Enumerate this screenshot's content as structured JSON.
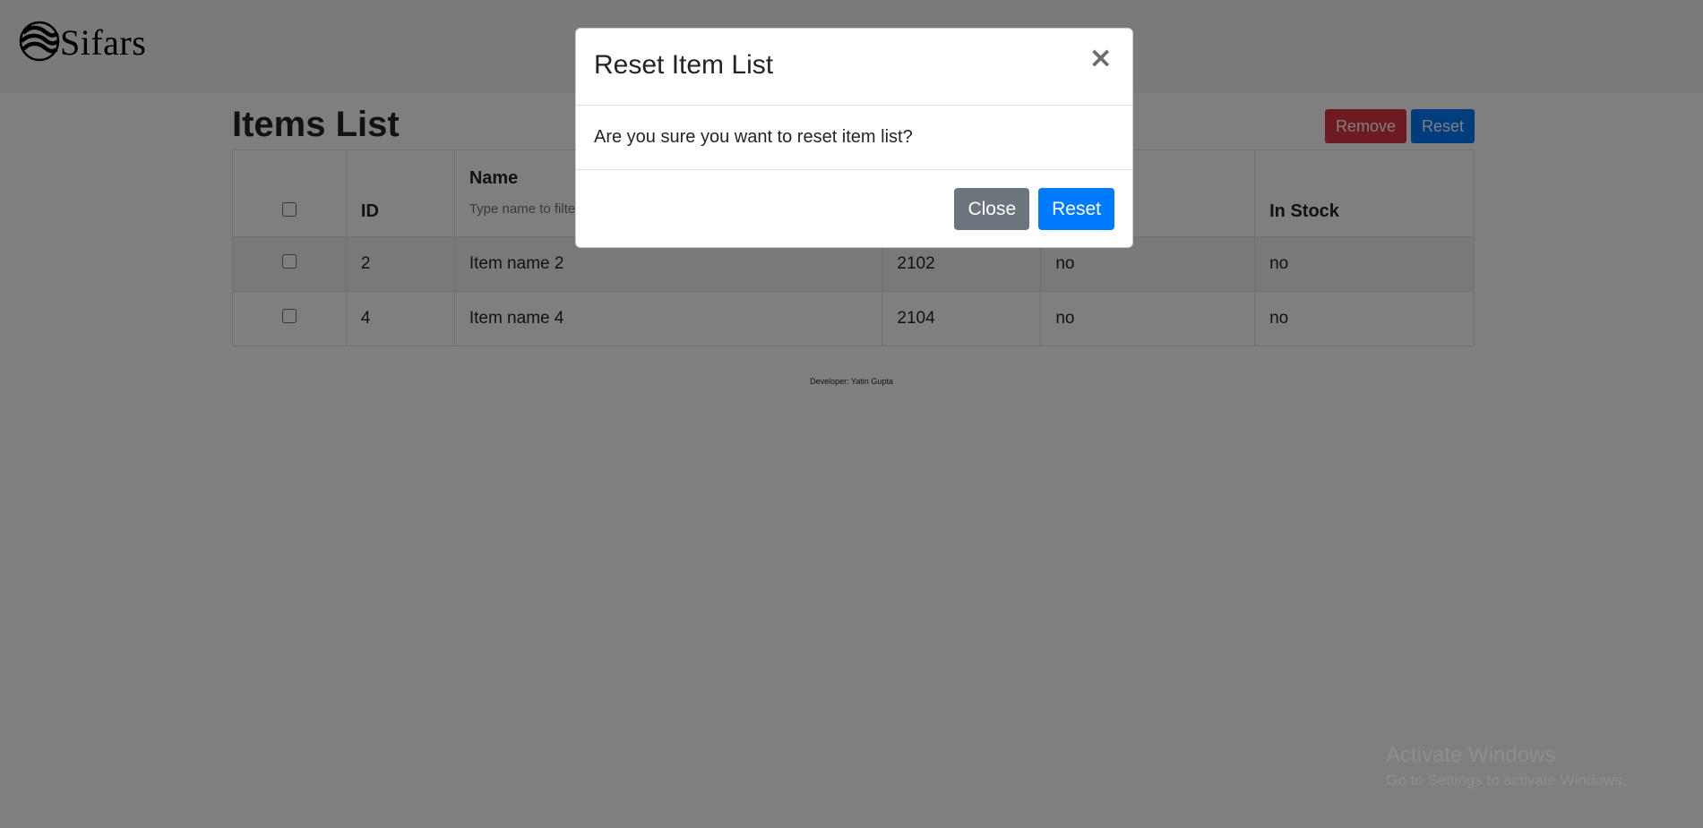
{
  "brand": {
    "name": "Sifars",
    "icon": "sifars-wave-logo-icon"
  },
  "page": {
    "title": "Items List"
  },
  "toolbar": {
    "remove_label": "Remove",
    "reset_label": "Reset"
  },
  "table": {
    "headers": {
      "id": "ID",
      "name": "Name",
      "name_filter_placeholder": "Type name to filter",
      "in_stock": "In Stock"
    },
    "rows": [
      {
        "id": "2",
        "name": "Item name 2",
        "code": "2102",
        "col4": "no",
        "in_stock": "no"
      },
      {
        "id": "4",
        "name": "Item name 4",
        "code": "2104",
        "col4": "no",
        "in_stock": "no"
      }
    ]
  },
  "footer": {
    "text": "Developer: Yatin Gupta"
  },
  "modal": {
    "title": "Reset Item List",
    "close_symbol": "×",
    "body": "Are you sure you want to reset item list?",
    "close_label": "Close",
    "reset_label": "Reset"
  },
  "watermark": {
    "title": "Activate Windows",
    "subtitle": "Go to Settings to activate Windows."
  },
  "colors": {
    "danger": "#dc3545",
    "primary": "#007bff",
    "secondary": "#6c757d",
    "backdrop": "rgba(0,0,0,0.5)"
  }
}
